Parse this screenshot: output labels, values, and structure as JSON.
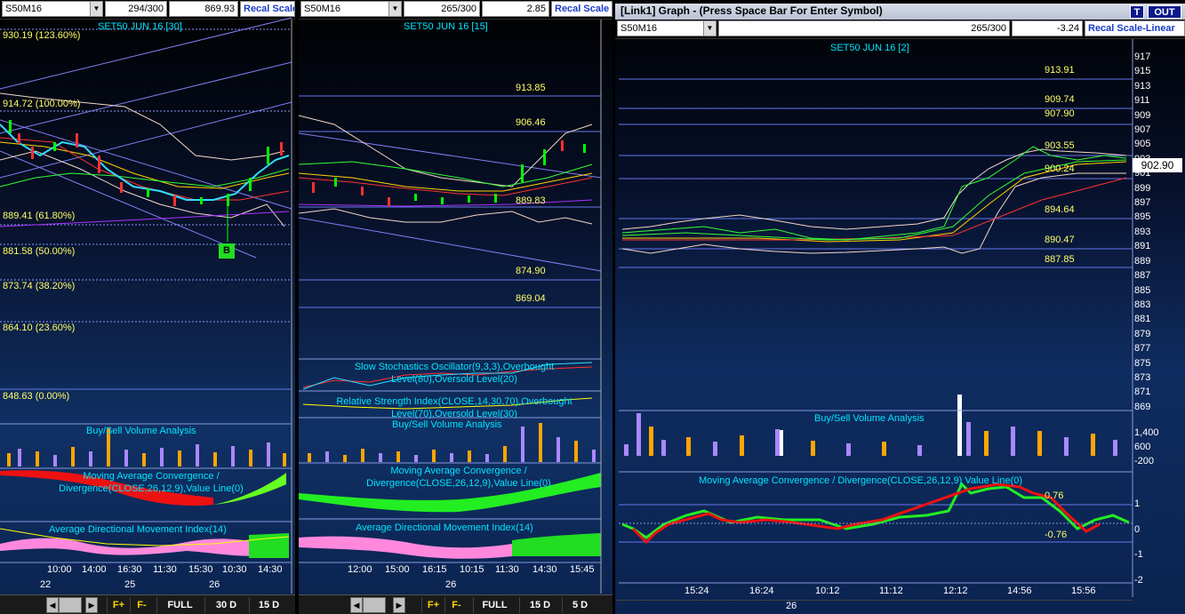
{
  "panel1": {
    "symbol": "S50M16",
    "count": "294/300",
    "value": "869.93",
    "recal": "Recal Scale",
    "title": "SET50 JUN 16  [30]",
    "fib": [
      "930.19 (123.60%)",
      "914.72 (100.00%)",
      "889.41 (61.80%)",
      "881.58 (50.00%)",
      "873.74 (38.20%)",
      "864.10 (23.60%)",
      "848.63 (0.00%)"
    ],
    "marker": "B",
    "volume_title": "Buy/Sell Volume Analysis",
    "macd_title": "Moving Average Convergence / Divergence(CLOSE,26,12,9),Value Line(0)",
    "adx_title": "Average Directional Movement Index(14)",
    "times": [
      "10:00",
      "14:00",
      "16:30",
      "11:30",
      "15:30",
      "10:30",
      "14:30"
    ],
    "dates": [
      "22",
      "25",
      "26"
    ],
    "buttons": {
      "f_plus": "F+",
      "f_minus": "F-",
      "full": "FULL",
      "d30": "30 D",
      "d15": "15 D"
    }
  },
  "panel2": {
    "symbol": "S50M16",
    "count": "265/300",
    "value": "2.85",
    "recal": "Recal Scale",
    "title": "SET50 JUN 16  [15]",
    "levels": [
      "913.85",
      "906.46",
      "889.83",
      "874.90",
      "869.04"
    ],
    "stoch_title": "Slow Stochastics Oscillator(9,3,3),Overbought Level(80),Oversold Level(20)",
    "rsi_title": "Relative Strength Index(CLOSE,14,30,70),Overbought Level(70),Oversold Level(30)",
    "volume_title": "Buy/Sell Volume Analysis",
    "macd_title": "Moving Average Convergence / Divergence(CLOSE,26,12,9),Value Line(0)",
    "adx_title": "Average Directional Movement Index(14)",
    "times": [
      "12:00",
      "15:00",
      "16:15",
      "10:15",
      "11:30",
      "14:30",
      "15:45"
    ],
    "dates": [
      "26"
    ],
    "buttons": {
      "f_plus": "F+",
      "f_minus": "F-",
      "full": "FULL",
      "d15": "15 D",
      "d5": "5 D"
    }
  },
  "panel3": {
    "window_title": "[Link1] Graph  - (Press Space Bar For Enter Symbol)",
    "btn_t": "T",
    "btn_out": "OUT",
    "symbol": "S50M16",
    "count": "265/300",
    "value": "-3.24",
    "recal": "Recal Scale-Linear",
    "title": "SET50 JUN 16  [2]",
    "levels": [
      "913.91",
      "909.74",
      "907.90",
      "903.55",
      "900.24",
      "894.64",
      "890.47",
      "887.85"
    ],
    "price_ticks": [
      "917",
      "915",
      "913",
      "911",
      "909",
      "907",
      "905",
      "903",
      "901",
      "899",
      "897",
      "895",
      "893",
      "891",
      "889",
      "887",
      "885",
      "883",
      "881",
      "879",
      "877",
      "875",
      "873",
      "871",
      "869"
    ],
    "last_price": "902.90",
    "volume_title": "Buy/Sell Volume Analysis",
    "volume_ticks": [
      "1,400",
      "600",
      "-200"
    ],
    "macd_title": "Moving Average Convergence / Divergence(CLOSE,26,12,9) Value Line(0)",
    "macd_levels": [
      "0.76",
      "-0.76"
    ],
    "macd_ticks": [
      "1",
      "0",
      "-1",
      "-2"
    ],
    "times": [
      "15:24",
      "16:24",
      "10:12",
      "11:12",
      "12:12",
      "14:56",
      "15:56"
    ],
    "dates": [
      "26"
    ]
  },
  "colors": {
    "bg_top": "#000000",
    "bg_bottom": "#103064",
    "title": "#00e5ff",
    "level": "#ffff66",
    "grid": "#5a6fd0",
    "recal": "#1a3cc8"
  }
}
